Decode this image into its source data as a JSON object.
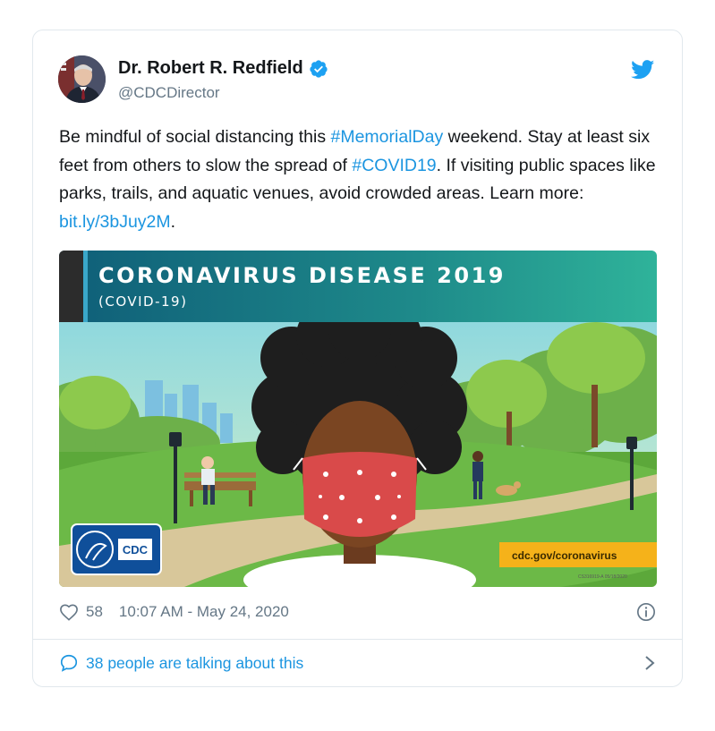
{
  "tweet": {
    "author": {
      "name": "Dr. Robert R. Redfield",
      "handle": "@CDCDirector",
      "verified": true
    },
    "text": {
      "part1": "Be mindful of social distancing this ",
      "hashtag1": "#MemorialDay",
      "part2": " weekend. Stay at least six feet from others to slow the spread of ",
      "hashtag2": "#COVID19",
      "part3": ". If visiting public spaces like parks, trails, and aquatic venues, avoid crowded areas. Learn more: ",
      "link": "bit.ly/3bJuy2M",
      "part4": "."
    },
    "media": {
      "title": "CORONAVIRUS DISEASE 2019",
      "subtitle": "(COVID-19)",
      "badge": "CDC",
      "url_label": "cdc.gov/coronavirus",
      "code": "CS316919-A 05/18/2020"
    },
    "likes": "58",
    "timestamp": "10:07 AM - May 24, 2020",
    "conversation": "38 people are talking about this"
  },
  "colors": {
    "link": "#1b95e0",
    "secondary": "#657786",
    "banner": "#1a7a8a",
    "mask": "#d94a4a",
    "url_bar": "#f5b21a"
  }
}
